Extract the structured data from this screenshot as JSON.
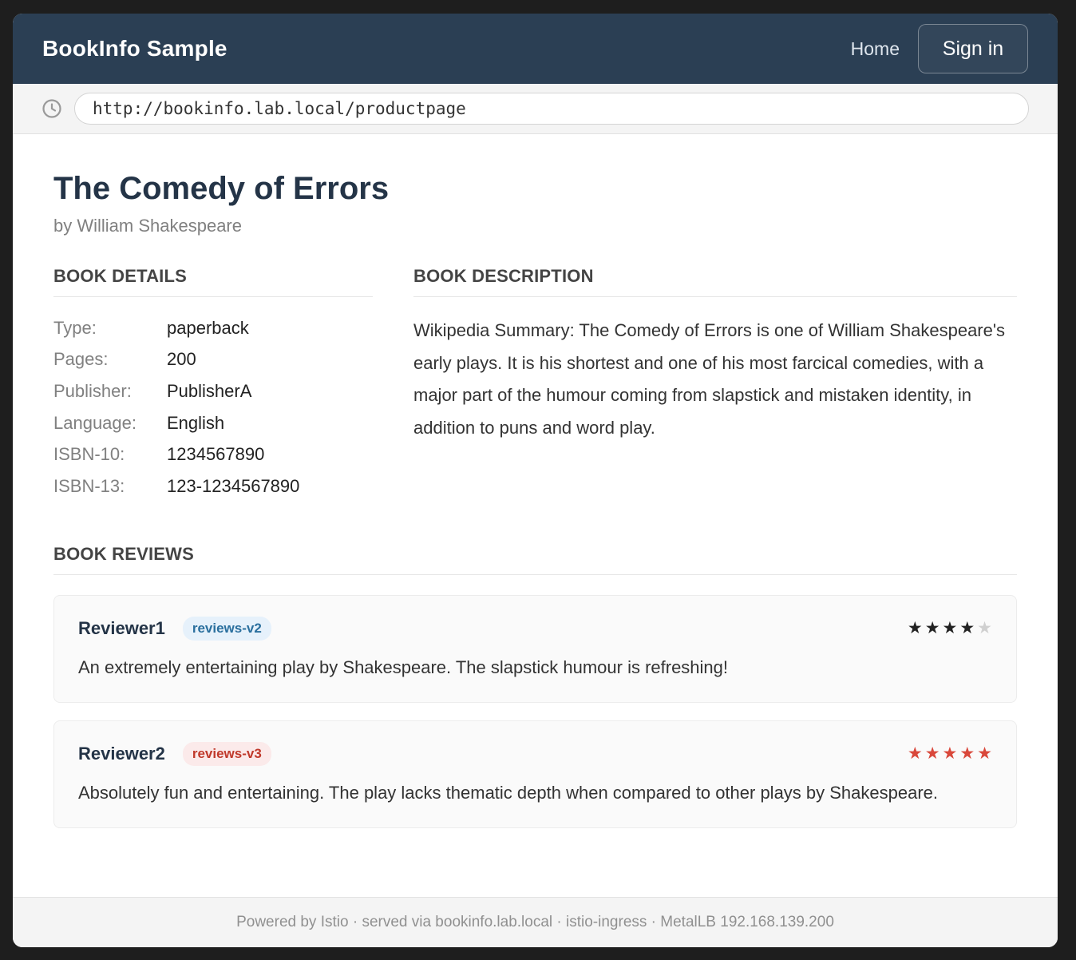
{
  "navbar": {
    "brand": "BookInfo Sample",
    "home_label": "Home",
    "signin_label": "Sign in"
  },
  "urlbar": {
    "icon": "clock-icon",
    "url": "http://bookinfo.lab.local/productpage"
  },
  "product": {
    "title": "The Comedy of Errors",
    "author": "by William Shakespeare"
  },
  "details": {
    "heading": "BOOK DETAILS",
    "rows": [
      {
        "label": "Type:",
        "value": "paperback"
      },
      {
        "label": "Pages:",
        "value": "200"
      },
      {
        "label": "Publisher:",
        "value": "PublisherA"
      },
      {
        "label": "Language:",
        "value": "English"
      },
      {
        "label": "ISBN-10:",
        "value": "1234567890"
      },
      {
        "label": "ISBN-13:",
        "value": "123-1234567890"
      }
    ]
  },
  "description": {
    "heading": "BOOK DESCRIPTION",
    "text": "Wikipedia Summary: The Comedy of Errors is one of William Shakespeare's early plays. It is his shortest and one of his most farcical comedies, with a major part of the humour coming from slapstick and mistaken identity, in addition to puns and word play."
  },
  "reviews": {
    "heading": "BOOK REVIEWS",
    "items": [
      {
        "reviewer": "Reviewer1",
        "badge": "reviews-v2",
        "text": "An extremely entertaining play by Shakespeare. The slapstick humour is refreshing!",
        "rating": 4,
        "max_rating": 5,
        "star_color": "#222222"
      },
      {
        "reviewer": "Reviewer2",
        "badge": "reviews-v3",
        "text": "Absolutely fun and entertaining. The play lacks thematic depth when compared to other plays by Shakespeare.",
        "rating": 5,
        "max_rating": 5,
        "star_color": "#d9483b"
      }
    ]
  },
  "footer": {
    "text": "Powered by Istio · served via bookinfo.lab.local · istio-ingress · MetalLB 192.168.139.200"
  },
  "colors": {
    "navbar_bg": "#2b3f54",
    "title": "#243447",
    "empty_star": "#d0d0d0"
  }
}
